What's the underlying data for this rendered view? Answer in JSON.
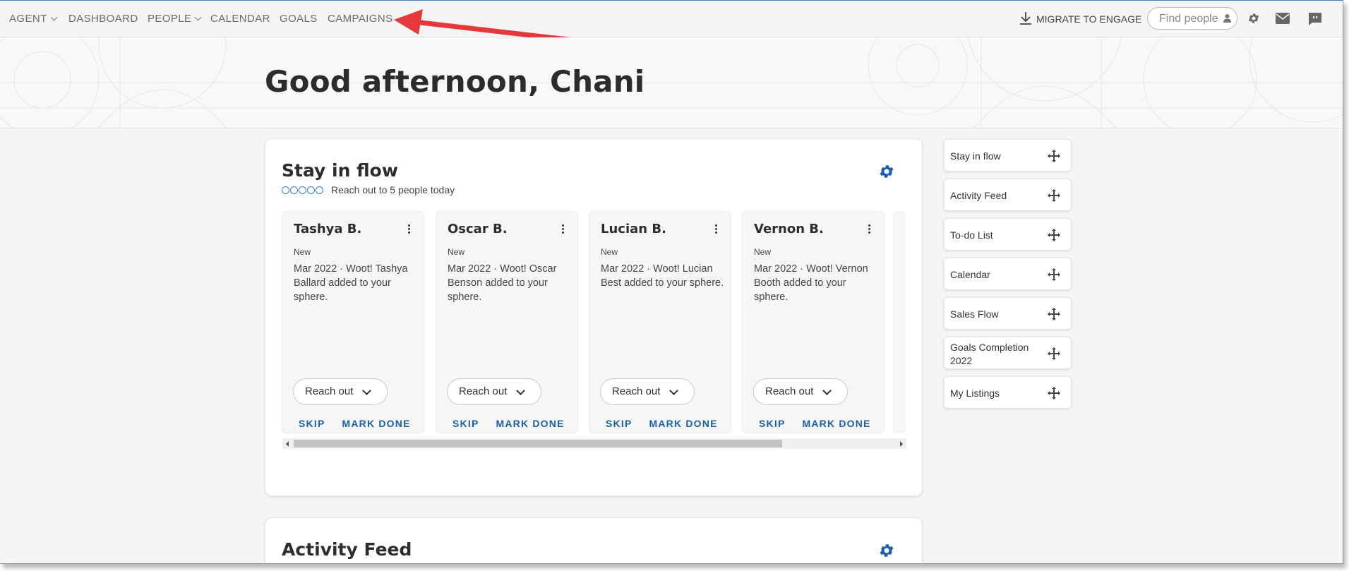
{
  "nav": {
    "items": [
      {
        "label": "AGENT",
        "dropdown": true
      },
      {
        "label": "DASHBOARD",
        "dropdown": false
      },
      {
        "label": "PEOPLE",
        "dropdown": true
      },
      {
        "label": "CALENDAR",
        "dropdown": false
      },
      {
        "label": "GOALS",
        "dropdown": false
      },
      {
        "label": "CAMPAIGNS",
        "dropdown": false
      }
    ],
    "migrate_label": "MIGRATE TO ENGAGE",
    "find_people_placeholder": "Find people",
    "icons": [
      "download-icon",
      "person-icon",
      "gear-icon",
      "mail-icon",
      "chat-icon"
    ]
  },
  "annotation": {
    "arrow_color": "#e5383b",
    "points_to": "CAMPAIGNS"
  },
  "greeting": "Good afternoon, Chani",
  "stay_in_flow": {
    "title": "Stay in flow",
    "subtitle": "Reach out to 5 people today",
    "progress_done": 0,
    "progress_total": 5,
    "cards": [
      {
        "name": "Tashya B.",
        "status": "New",
        "desc": "Mar 2022 · Woot! Tashya Ballard added to your sphere.",
        "reach": "Reach out",
        "skip": "SKIP",
        "done": "MARK DONE"
      },
      {
        "name": "Oscar B.",
        "status": "New",
        "desc": "Mar 2022 · Woot! Oscar Benson added to your sphere.",
        "reach": "Reach out",
        "skip": "SKIP",
        "done": "MARK DONE"
      },
      {
        "name": "Lucian B.",
        "status": "New",
        "desc": "Mar 2022 · Woot! Lucian Best added to your sphere.",
        "reach": "Reach out",
        "skip": "SKIP",
        "done": "MARK DONE"
      },
      {
        "name": "Vernon B.",
        "status": "New",
        "desc": "Mar 2022 · Woot! Vernon Booth added to your sphere.",
        "reach": "Reach out",
        "skip": "SKIP",
        "done": "MARK DONE"
      }
    ]
  },
  "activity_feed": {
    "title": "Activity Feed"
  },
  "widgets": [
    "Stay in flow",
    "Activity Feed",
    "To-do List",
    "Calendar",
    "Sales Flow",
    "Goals Completion 2022",
    "My Listings"
  ],
  "colors": {
    "accent": "#1a5fa8",
    "arrow": "#e5383b"
  }
}
